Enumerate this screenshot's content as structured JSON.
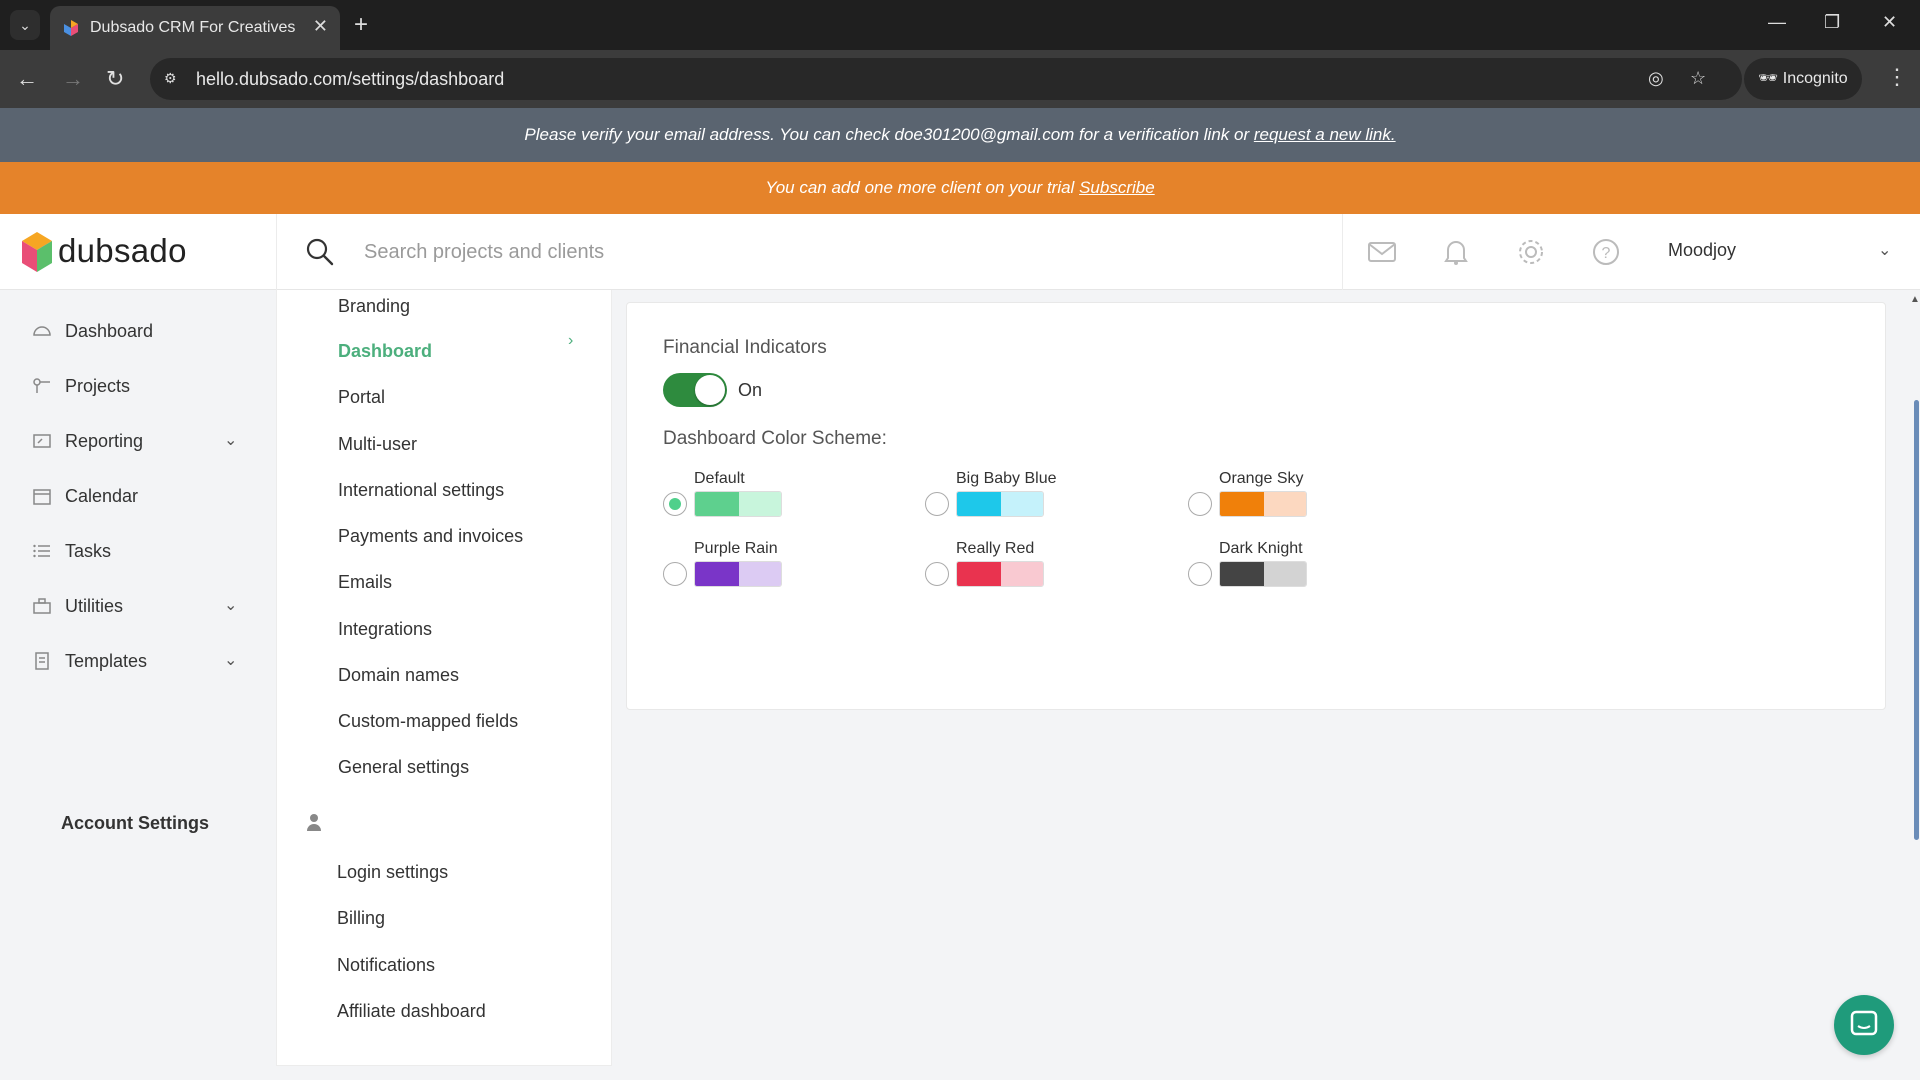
{
  "browser": {
    "tab_title": "Dubsado CRM For Creatives",
    "url": "hello.dubsado.com/settings/dashboard",
    "incognito_label": "Incognito"
  },
  "banners": {
    "verify_text": "Please verify your email address. You can check doe301200@gmail.com for a verification link or",
    "verify_link": "request a new link.",
    "trial_text": "You can add one more client on your trial",
    "trial_link": "Subscribe"
  },
  "header": {
    "logo_text": "dubsado",
    "search_placeholder": "Search projects and clients",
    "user_name": "Moodjoy"
  },
  "left_nav": {
    "items": [
      {
        "label": "Dashboard",
        "icon": "dashboard-icon"
      },
      {
        "label": "Projects",
        "icon": "projects-icon"
      },
      {
        "label": "Reporting",
        "icon": "reporting-icon",
        "expandable": true
      },
      {
        "label": "Calendar",
        "icon": "calendar-icon"
      },
      {
        "label": "Tasks",
        "icon": "tasks-icon"
      },
      {
        "label": "Utilities",
        "icon": "utilities-icon",
        "expandable": true
      },
      {
        "label": "Templates",
        "icon": "templates-icon",
        "expandable": true
      }
    ]
  },
  "settings_nav": {
    "items": [
      "Branding",
      "Dashboard",
      "Portal",
      "Multi-user",
      "International settings",
      "Payments and invoices",
      "Emails",
      "Integrations",
      "Domain names",
      "Custom-mapped fields",
      "General settings"
    ],
    "active": "Dashboard",
    "account_section": "Account Settings",
    "account_items": [
      "Login settings",
      "Billing",
      "Notifications",
      "Affiliate dashboard"
    ]
  },
  "main": {
    "financial_indicators_label": "Financial Indicators",
    "toggle_state": "On",
    "color_scheme_label": "Dashboard Color Scheme:",
    "schemes": [
      {
        "name": "Default",
        "colors": [
          "#5ed08e",
          "#c8f5dc"
        ],
        "selected": true
      },
      {
        "name": "Big Baby Blue",
        "colors": [
          "#1ec8ea",
          "#c5f2fb"
        ],
        "selected": false
      },
      {
        "name": "Orange Sky",
        "colors": [
          "#f0800a",
          "#fcd8c0"
        ],
        "selected": false
      },
      {
        "name": "Purple Rain",
        "colors": [
          "#7a35c8",
          "#dccbf3"
        ],
        "selected": false
      },
      {
        "name": "Really Red",
        "colors": [
          "#e9334f",
          "#f9c9d1"
        ],
        "selected": false
      },
      {
        "name": "Dark Knight",
        "colors": [
          "#444444",
          "#d3d3d3"
        ],
        "selected": false
      }
    ]
  },
  "colors": {
    "accent_green": "#4caf7d",
    "trial_orange": "#e5832a",
    "verify_gray": "#5a6470",
    "toggle_green": "#2e8b3e"
  }
}
